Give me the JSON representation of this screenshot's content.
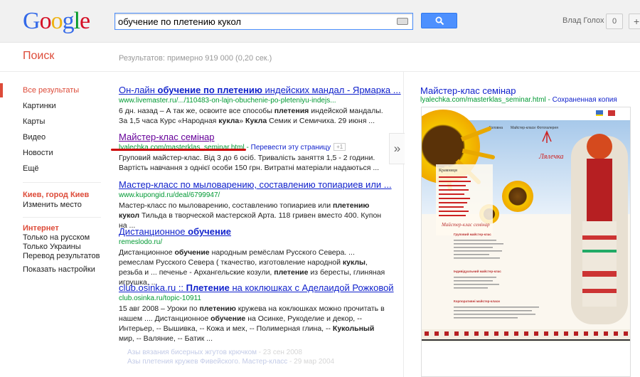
{
  "header": {
    "logo": [
      "G",
      "o",
      "o",
      "g",
      "l",
      "e"
    ],
    "logo_colors": [
      "#3369e8",
      "#d50f25",
      "#eeb211",
      "#3369e8",
      "#009925",
      "#d50f25"
    ],
    "search_value": "обучение по плетению кукол",
    "user_name": "Влад Голох",
    "notification_count": "0",
    "share_label": "+"
  },
  "subbar": {
    "search_label": "Поиск",
    "results_stats": "Результатов: примерно 919 000 (0,20 сек.)"
  },
  "nav": {
    "items": [
      "Все результаты",
      "Картинки",
      "Карты",
      "Видео",
      "Новости",
      "Ещё"
    ],
    "location": "Киев, город Киев",
    "change_location": "Изменить место",
    "internet_heading": "Интернет",
    "filters": [
      "Только на русском",
      "Только Украины",
      "Перевод результатов",
      "Показать настройки"
    ]
  },
  "results": [
    {
      "title_parts": [
        "Он-лайн ",
        "обучение по плетению",
        " индейских мандал - Ярмарка ..."
      ],
      "url": "www.livemaster.ru/.../110483-on-lajn-obuchenie-po-pleteniyu-indejs...",
      "snippet_parts": [
        "6 дн. назад – А так же, освоите все способы ",
        "плетения",
        " индейской мандалы. За 1,5 часа Курс «Народная ",
        "кукла",
        "» ",
        "Кукла",
        " Семик и Семичиха. 29 июня ..."
      ]
    },
    {
      "title": "Майстер-клас семінар",
      "url": "lyalechka.com/masterklas_seminar.html",
      "translate": "Перевести эту страницу",
      "plus": "+1",
      "snippet": "Груповий майстер-клас. Від 3 до 6 осіб. Тривалість заняття 1,5 - 2 години. Вартість навчання з однієї особи 150 грн. Витратні матеріали надаються ..."
    },
    {
      "title": "Мастер-класс по мыловарению, составлению топиариев или ...",
      "url": "www.kupongid.ru/deal/6799947/",
      "snippet_parts": [
        "Мастер-класс по мыловарению, составлению топиариев или ",
        "плетению кукол",
        " Тильда в творческой мастерской Арта. 118 гривен вместо 400. Купон на ..."
      ]
    },
    {
      "title_parts": [
        "Дистанционное ",
        "обучение"
      ],
      "url": "remeslodo.ru/",
      "snippet_parts": [
        "Дистанционное ",
        "обучение",
        " народным ремёслам Русского Севера. ... ремеслам Русского Севера ( ткачество, изготовление народной ",
        "куклы",
        ", резьба и ... печенье - Архангельские козули, ",
        "плетение",
        " из бересты, глиняная игрушка, ..."
      ]
    },
    {
      "url_title": "club.osinka.ru :: ",
      "title_parts": [
        "Плетение",
        " на коклюшках с Аделаидой Рожковой"
      ],
      "url": "club.osinka.ru/topic-10911",
      "snippet_parts": [
        "15 авг 2008 – Уроки по ",
        "плетению",
        " кружева на коклюшках можно прочитать в нашем .... Дистанционное ",
        "обучение",
        " на Осинке, Рукоделие и декор, -- Интерьер, -- Вышивка, -- Кожа и мех, -- Полимерная глина, -- ",
        "Кукольный",
        " мир, -- Валяние, -- Батик ..."
      ],
      "sublinks": [
        {
          "text": "Азы вязания бисерных жгутов крючком",
          "date": " - 23 сен 2008"
        },
        {
          "text": "Азы плетения кружев Фивейского. Мастер-класс",
          "date": " - 29 мар 2004"
        }
      ]
    }
  ],
  "preview": {
    "title": "Майстер-клас семінар",
    "url": "lyalechka.com/masterklas_seminar.html",
    "cache": "Сохраненная копия",
    "site_logo": "Лялечка",
    "site_heading": "Майстер-клас семінар",
    "site_nav": [
      "Крамниця"
    ],
    "site_section_1": "Груповий майстер-клас",
    "site_section_2": "Індивідуальний майстер-клас",
    "site_section_3": "Корпоративні майстер-класи"
  }
}
